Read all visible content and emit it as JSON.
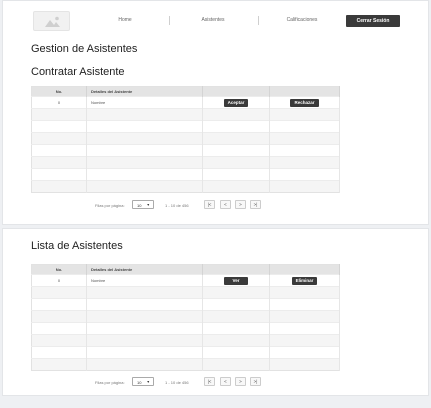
{
  "nav": {
    "logo_icon": "image-placeholder-icon",
    "links": [
      {
        "label": "Home"
      },
      {
        "label": "Asistentes"
      },
      {
        "label": "Calificaciones"
      }
    ],
    "logout_label": "Cerrar Sesión"
  },
  "page_title": "Gestion de Asistentes",
  "hire_section": {
    "title": "Contratar Asistente",
    "columns": {
      "no": "No.",
      "details": "Detalles del Asistente",
      "action1": "",
      "action2": ""
    },
    "row": {
      "no": "0",
      "details": "Nombre",
      "accept_label": "Aceptar",
      "reject_label": "Rechazar"
    },
    "pager": {
      "rows_label": "Filas por página:",
      "rows_value": "10",
      "range": "1 - 10 de 456",
      "buttons": [
        "|<",
        "<",
        ">",
        ">|"
      ]
    }
  },
  "list_section": {
    "title": "Lista de Asistentes",
    "columns": {
      "no": "No.",
      "details": "Detalles del Asistente",
      "action1": "",
      "action2": ""
    },
    "row": {
      "no": "0",
      "details": "Nombre",
      "view_label": "Ver",
      "delete_label": "Eliminar"
    },
    "pager": {
      "rows_label": "Filas por página:",
      "rows_value": "10",
      "range": "1 - 10 de 456",
      "buttons": [
        "|<",
        "<",
        ">",
        ">|"
      ]
    }
  }
}
